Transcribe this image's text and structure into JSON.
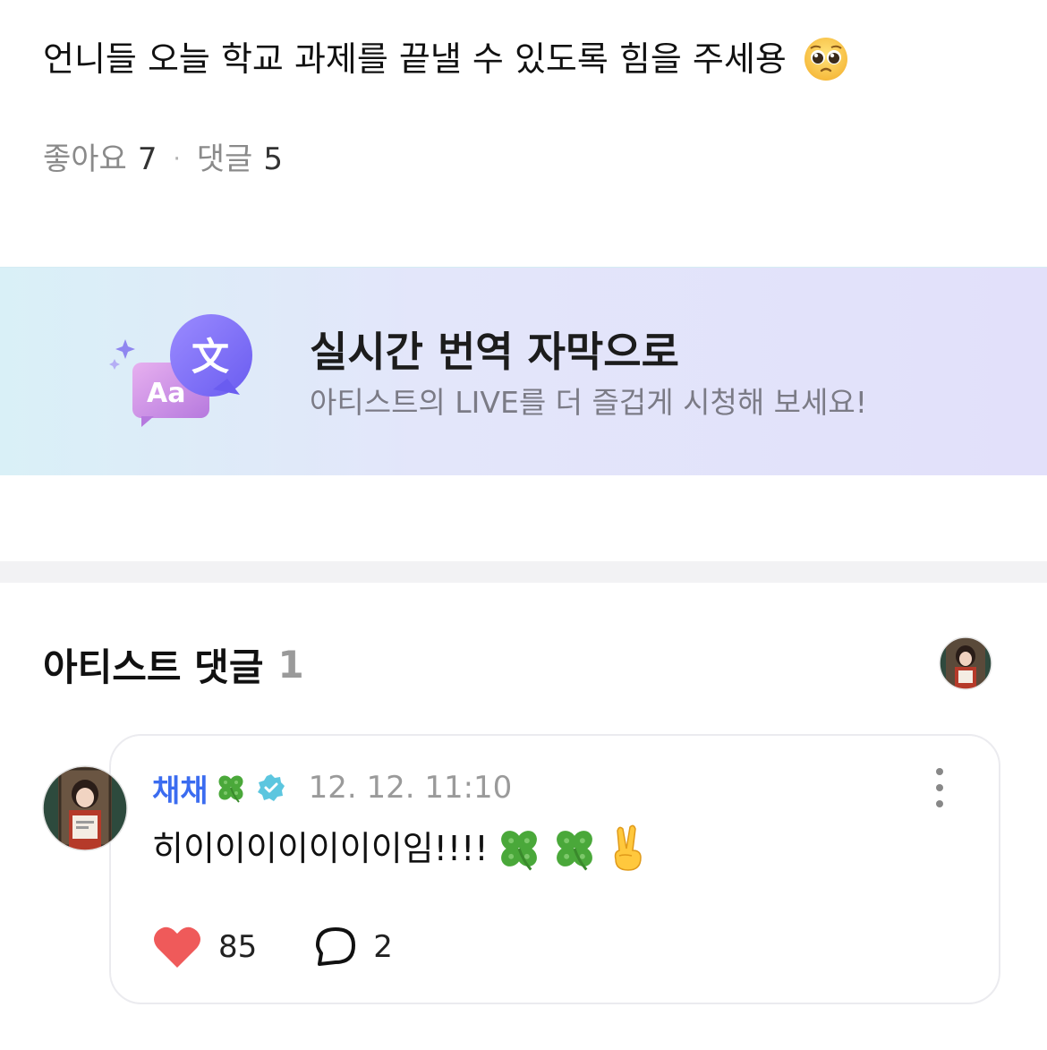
{
  "post": {
    "text": "언니들 오늘 학교 과제를 끝낼 수 있도록 힘을 주세용",
    "emoji": "pleading-face-emoji",
    "likes_label": "좋아요",
    "likes_count": "7",
    "separator": "·",
    "comments_label": "댓글",
    "comments_count": "5"
  },
  "banner": {
    "title": "실시간 번역 자막으로",
    "subtitle": "아티스트의 LIVE를 더 즐겁게 시청해 보세요!",
    "icon_glyph_cjk": "文",
    "icon_glyph_latin": "Aa",
    "accent_purple": "#7b6cf6",
    "accent_pink": "#c98ce6"
  },
  "artist_comments": {
    "title": "아티스트 댓글",
    "count": "1"
  },
  "comment": {
    "author": "채채",
    "author_emoji": "four-leaf-clover-emoji",
    "verified_icon": "verified-badge-icon",
    "timestamp": "12. 12. 11:10",
    "text": "히이이이이이이이임!!!!",
    "text_emojis": [
      "four-leaf-clover-emoji",
      "four-leaf-clover-emoji",
      "victory-hand-emoji"
    ],
    "like_count": "85",
    "reply_count": "2",
    "author_color": "#3b6cf0",
    "heart_color": "#ef5a5a"
  }
}
